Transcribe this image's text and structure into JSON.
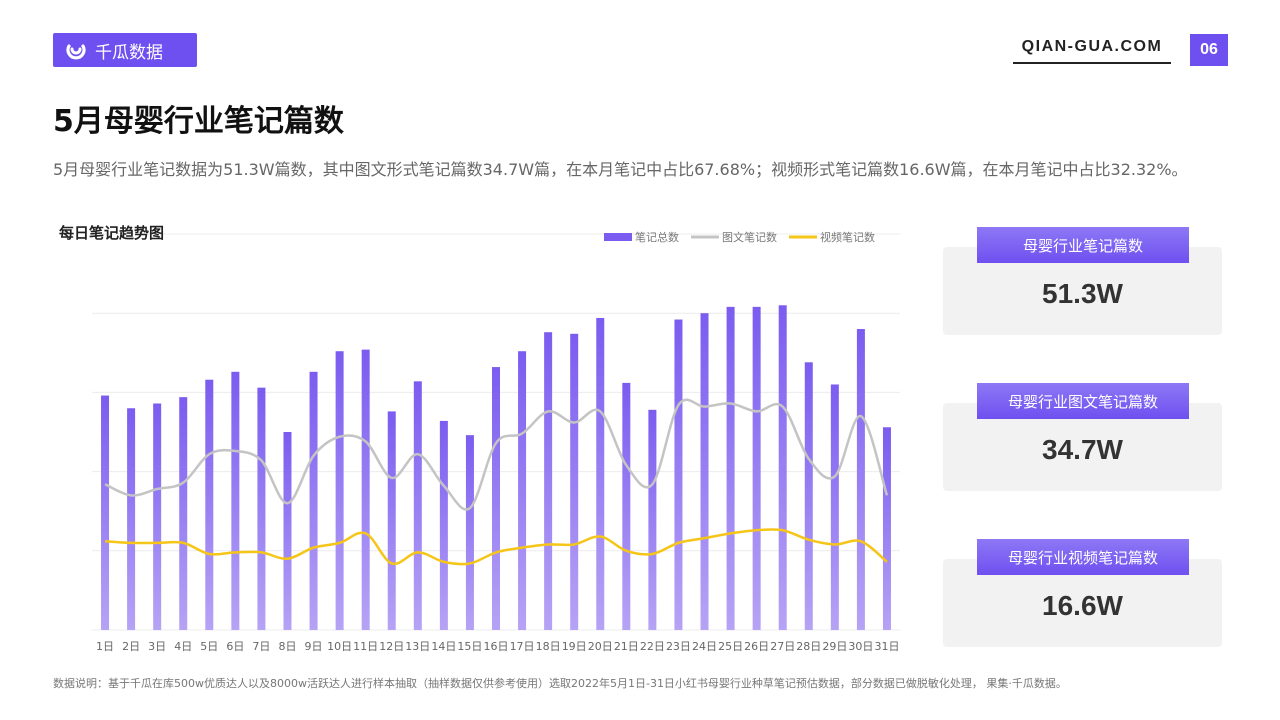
{
  "header": {
    "logo_text": "千瓜数据",
    "site": "QIAN-GUA.COM",
    "page_number": "06"
  },
  "title": "5月母婴行业笔记篇数",
  "description": "5月母婴行业笔记数据为51.3W篇数，其中图文形式笔记篇数34.7W篇，在本月笔记中占比67.68%；视频形式笔记篇数16.6W篇，在本月笔记中占比32.32%。",
  "chart_heading": "每日笔记趋势图",
  "cards": [
    {
      "label": "母婴行业笔记篇数",
      "value": "51.3W"
    },
    {
      "label": "母婴行业图文笔记篇数",
      "value": "34.7W"
    },
    {
      "label": "母婴行业视频笔记篇数",
      "value": "16.6W"
    }
  ],
  "footnote": "数据说明：基于千瓜在库500w优质达人以及8000w活跃达人进行样本抽取（抽样数据仅供参考使用）选取2022年5月1日-31日小红书母婴行业种草笔记预估数据，部分数据已做脱敏化处理， 果集·千瓜数据。",
  "colors": {
    "accent": "#6e50f0",
    "bar_top": "#7b5cf0",
    "bar_bottom": "#b6a3f5",
    "line_image": "#c4c4c4",
    "line_video": "#f5c518"
  },
  "chart_data": {
    "type": "bar",
    "title": "",
    "xlabel": "",
    "ylabel": "",
    "ylim": [
      0,
      25000
    ],
    "grid": true,
    "legend": "top-right",
    "categories": [
      "1日",
      "2日",
      "3日",
      "4日",
      "5日",
      "6日",
      "7日",
      "8日",
      "9日",
      "10日",
      "11日",
      "12日",
      "13日",
      "14日",
      "15日",
      "16日",
      "17日",
      "18日",
      "19日",
      "20日",
      "21日",
      "22日",
      "23日",
      "24日",
      "25日",
      "26日",
      "27日",
      "28日",
      "29日",
      "30日",
      "31日"
    ],
    "series": [
      {
        "name": "笔记总数",
        "kind": "bar",
        "values": [
          14800,
          14000,
          14300,
          14700,
          15800,
          16300,
          15300,
          12500,
          16300,
          17600,
          17700,
          13800,
          15700,
          13200,
          12300,
          16600,
          17600,
          18800,
          18700,
          19700,
          15600,
          13900,
          19600,
          20000,
          20400,
          20400,
          20500,
          16900,
          15500,
          19000,
          12800
        ]
      },
      {
        "name": "图文笔记数",
        "kind": "line",
        "values": [
          9200,
          8500,
          8900,
          9300,
          11100,
          11300,
          10700,
          8000,
          11000,
          12200,
          11900,
          9600,
          11100,
          9100,
          7700,
          11800,
          12400,
          13800,
          13100,
          13800,
          10400,
          9200,
          14200,
          14100,
          14300,
          13800,
          14100,
          10800,
          9700,
          13500,
          8500
        ]
      },
      {
        "name": "视频笔记数",
        "kind": "line",
        "values": [
          5600,
          5500,
          5500,
          5500,
          4800,
          4900,
          4900,
          4500,
          5200,
          5500,
          6100,
          4200,
          4900,
          4300,
          4200,
          4900,
          5200,
          5400,
          5400,
          5900,
          5000,
          4800,
          5500,
          5800,
          6100,
          6300,
          6300,
          5700,
          5400,
          5600,
          4300
        ]
      }
    ]
  }
}
